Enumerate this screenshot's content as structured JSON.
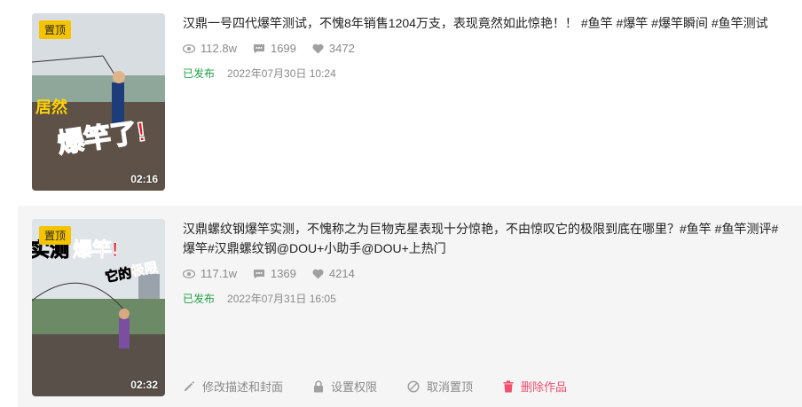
{
  "items": [
    {
      "pin_label": "置顶",
      "duration": "02:16",
      "thumb_overlay": "居然爆竿了!",
      "description": "汉鼎一号四代爆竿测试，不愧8年销售1204万支，表现竟然如此惊艳！！ #鱼竿 #爆竿 #爆竿瞬间 #鱼竿测试",
      "views": "112.8w",
      "comments": "1699",
      "likes": "3472",
      "status": "已发布",
      "date": "2022年07月30日 10:24"
    },
    {
      "pin_label": "置顶",
      "duration": "02:32",
      "thumb_overlay": "实测爆竿! 它的极限",
      "description": "汉鼎螺纹钢爆竿实测，不愧称之为巨物克星表现十分惊艳，不由惊叹它的极限到底在哪里？#鱼竿 #鱼竿测评#爆竿#汉鼎螺纹钢@DOU+小助手@DOU+上热门",
      "views": "117.1w",
      "comments": "1369",
      "likes": "4214",
      "status": "已发布",
      "date": "2022年07月31日 16:05",
      "actions": {
        "edit": "修改描述和封面",
        "permission": "设置权限",
        "unpin": "取消置顶",
        "delete": "删除作品"
      }
    }
  ],
  "colors": {
    "published": "#21a043",
    "delete": "#f0506e",
    "pin_badge": "#f5c400"
  },
  "icons": {
    "views": "eye-icon",
    "comments": "comment-icon",
    "likes": "heart-icon"
  }
}
